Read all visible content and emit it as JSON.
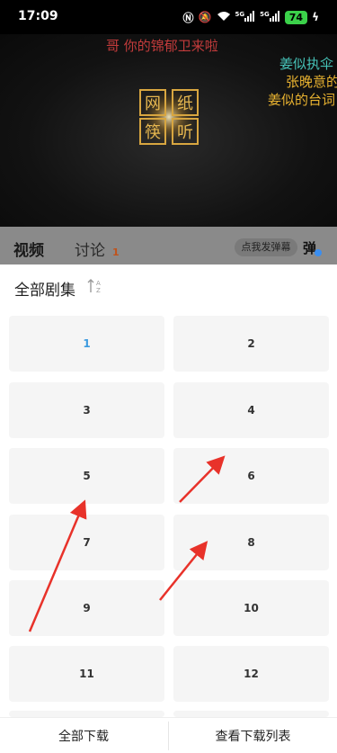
{
  "status_bar": {
    "time": "17:09",
    "network_1": "5G",
    "network_2": "5G",
    "battery": "74"
  },
  "video": {
    "danmu": [
      "哥 你的锦郁卫来啦",
      "姜似执伞",
      "张晚意的",
      "姜似的台词"
    ],
    "logo_text": [
      "网",
      "纸",
      "筷",
      "听"
    ]
  },
  "tabs": {
    "video": "视频",
    "discuss": "讨论",
    "discuss_count": "1",
    "danmu_placeholder": "点我发弹幕",
    "danmu_toggle": "弹"
  },
  "episodes": {
    "title": "全部剧集",
    "sort_icon": "sort-az-icon",
    "list": [
      "1",
      "2",
      "3",
      "4",
      "5",
      "6",
      "7",
      "8",
      "9",
      "10",
      "11",
      "12"
    ],
    "selected": "1"
  },
  "bottom": {
    "download_all": "全部下载",
    "download_list": "查看下载列表"
  },
  "colors": {
    "accent": "#3d9bdf",
    "arrow": "#e8322a"
  }
}
